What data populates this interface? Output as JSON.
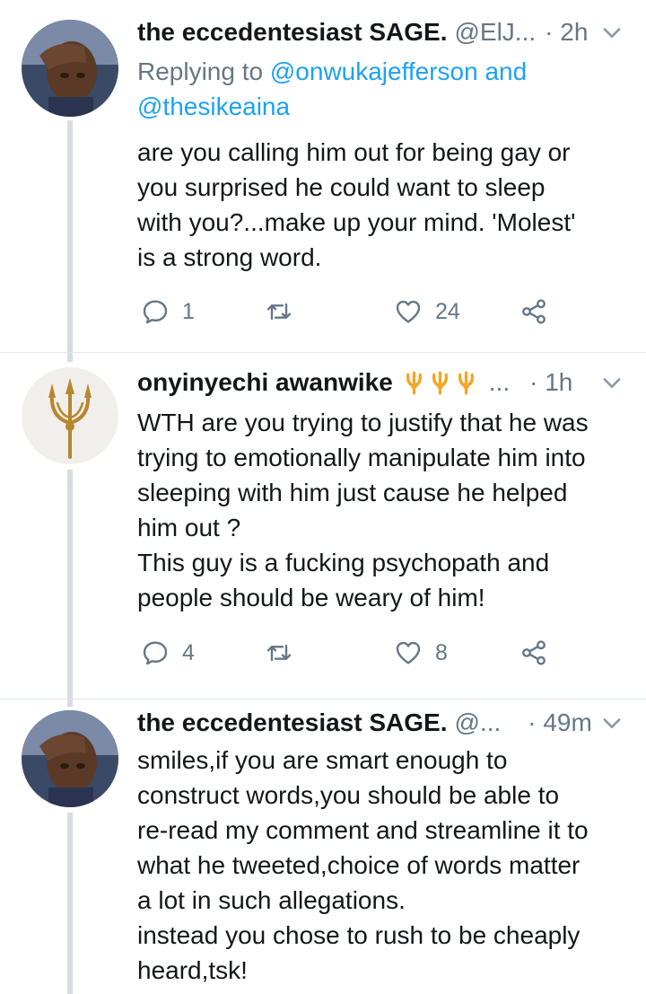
{
  "tweets": [
    {
      "name": "the eccedentesiast SAGE.",
      "handle": "@ElJ...",
      "time": "· 2h",
      "reply_prefix": "Replying to ",
      "mention1": "@onwukajefferson",
      "reply_and": " and",
      "mention2": "@thesikeaina",
      "text": "are you calling him out for being gay or\nyou surprised he could want to sleep\nwith you?...make up your mind. 'Molest'\nis a strong word.",
      "reply_count": "1",
      "retweet_count": "",
      "like_count": "24"
    },
    {
      "name": "onyinyechi awanwike",
      "handle": "...",
      "time": "· 1h",
      "badges": [
        "trident-emoji",
        "trident-emoji",
        "trident-emoji"
      ],
      "text": "WTH are you trying to justify that he was\ntrying to emotionally manipulate him into\nsleeping with him just cause he helped\nhim out ?\nThis guy is a fucking psychopath and\npeople should be weary of him!",
      "reply_count": "4",
      "retweet_count": "",
      "like_count": "8"
    },
    {
      "name": "the eccedentesiast SAGE.",
      "handle": "@...",
      "time": "· 49m",
      "text": "smiles,if you are smart enough to\nconstruct words,you should be able to\nre-read my comment and streamline it to\nwhat he tweeted,choice of words matter\na lot in such allegations.\ninstead you chose to rush to be cheaply\nheard,tsk!"
    }
  ],
  "colors": {
    "name": "#14171a",
    "secondary": "#657786",
    "link": "#1da1f2",
    "thread_line": "#d6dde3",
    "divider": "#e1e8ed"
  }
}
